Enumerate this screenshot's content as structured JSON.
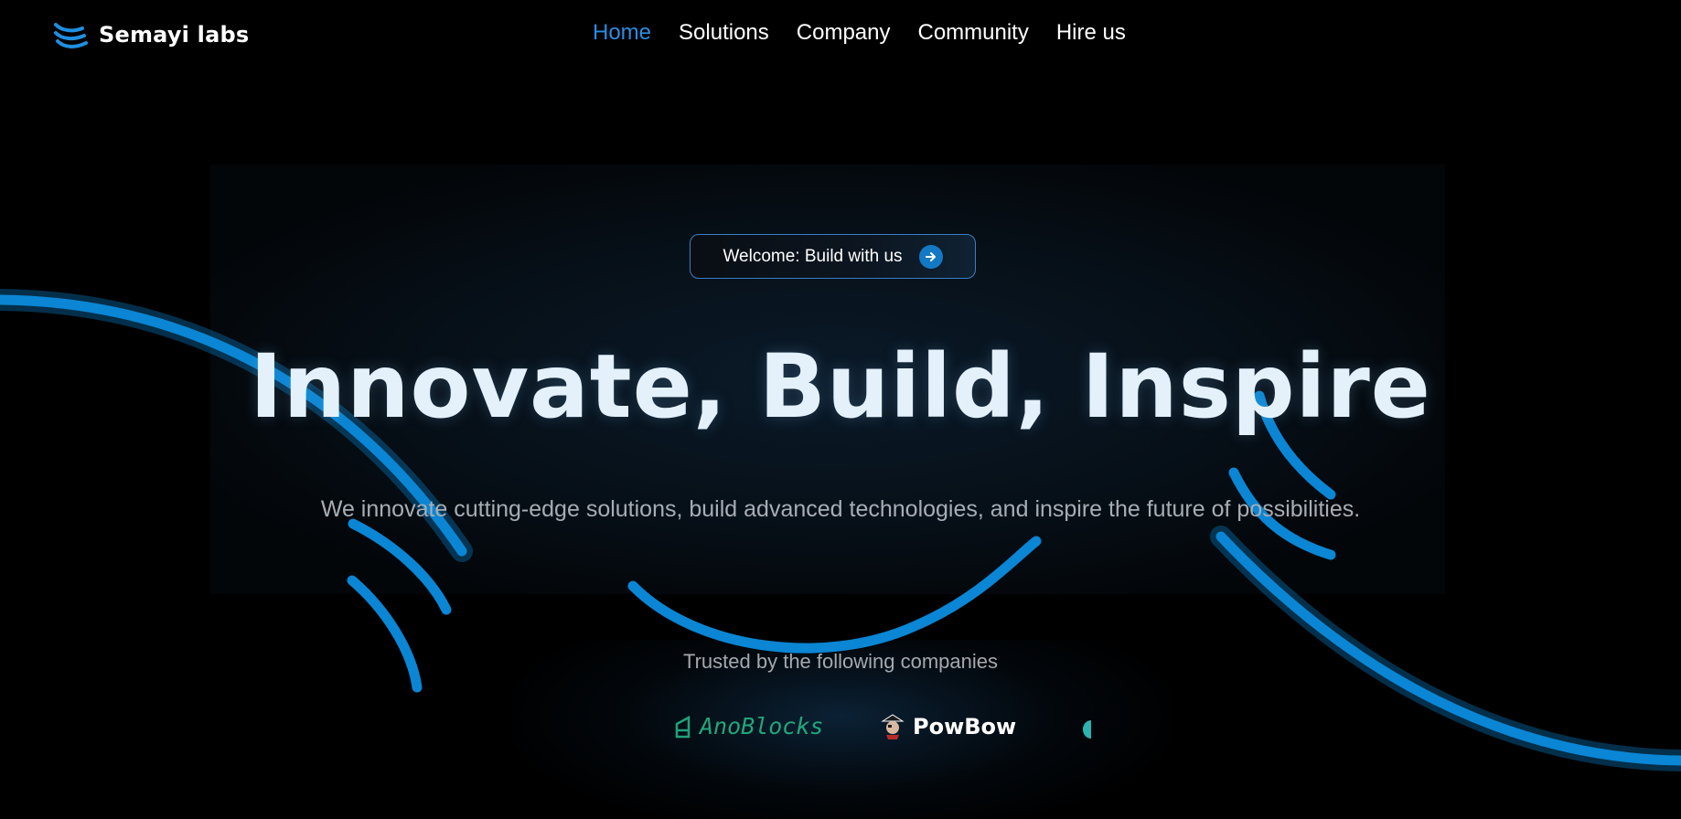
{
  "brand": {
    "name": "Semayi labs",
    "logo_icon": "wave-lines-icon"
  },
  "nav": {
    "items": [
      {
        "label": "Home",
        "active": true
      },
      {
        "label": "Solutions",
        "active": false
      },
      {
        "label": "Company",
        "active": false
      },
      {
        "label": "Community",
        "active": false
      },
      {
        "label": "Hire us",
        "active": false
      }
    ]
  },
  "hero": {
    "pill_label": "Welcome: Build with us",
    "pill_icon": "arrow-right-icon",
    "headline": "Innovate, Build, Inspire",
    "subtitle": "We innovate cutting-edge solutions, build advanced technologies, and inspire the future of possibilities."
  },
  "trusted": {
    "heading": "Trusted by the following companies",
    "companies": [
      {
        "name": "AnoBlocks",
        "icon": "anoblocks-logo-icon",
        "color": "#21a77c"
      },
      {
        "name": "PowBow",
        "icon": "pirate-mascot-icon",
        "color": "#ffffff"
      },
      {
        "name": "",
        "icon": "partial-logo-icon",
        "color": "#2bb3b0"
      }
    ]
  },
  "colors": {
    "background": "#000000",
    "accent": "#0a86d4",
    "nav_active": "#2a8ce0",
    "headline": "#e4f1fb",
    "subtitle": "#a7adb4"
  }
}
